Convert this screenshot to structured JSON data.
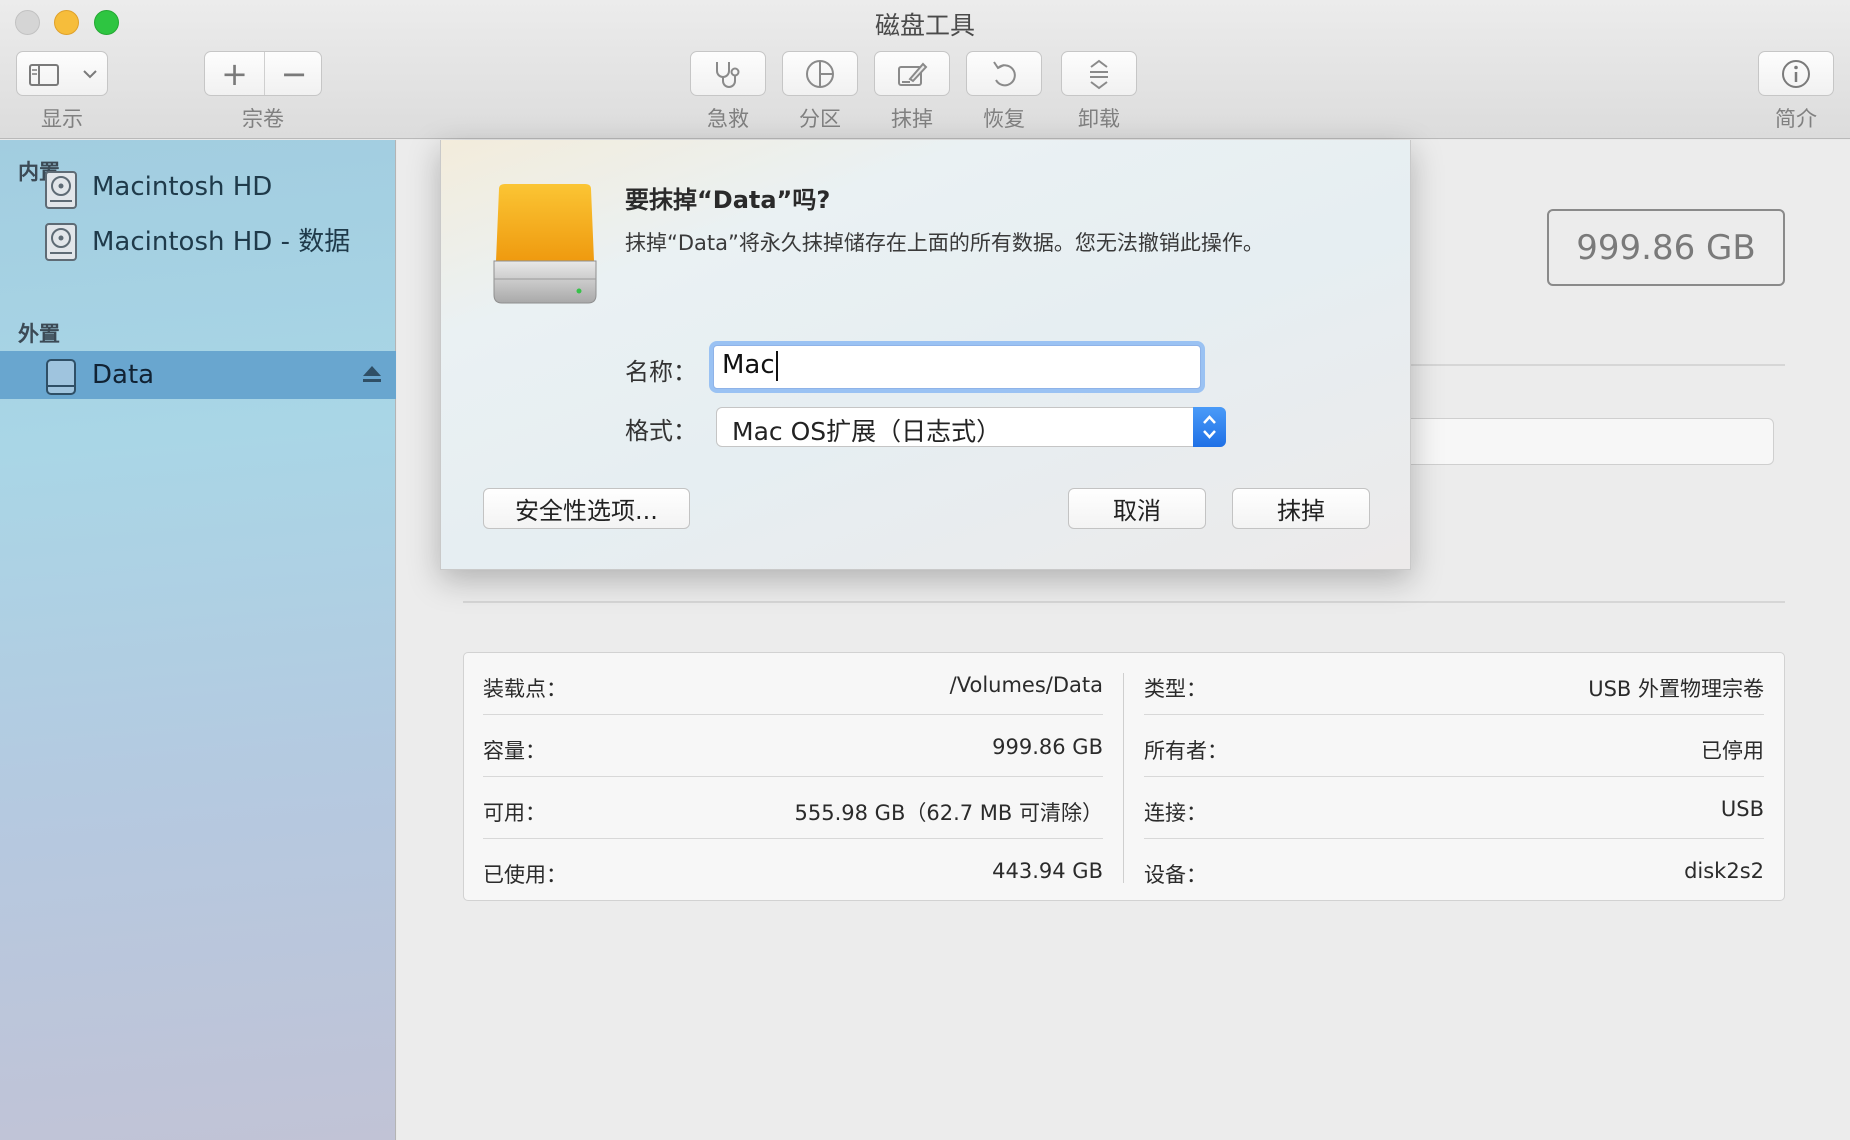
{
  "window": {
    "title": "磁盘工具"
  },
  "toolbar": {
    "view_label": "显示",
    "volume_label": "宗卷",
    "first_aid_label": "急救",
    "partition_label": "分区",
    "erase_label": "抹掉",
    "restore_label": "恢复",
    "unmount_label": "卸载",
    "info_label": "简介",
    "add_symbol": "+",
    "remove_symbol": "−"
  },
  "sidebar": {
    "internal_header": "内置",
    "external_header": "外置",
    "internal_items": [
      {
        "label": "Macintosh HD",
        "icon": "hard-disk-icon"
      },
      {
        "label": "Macintosh HD - 数据",
        "icon": "hard-disk-icon"
      }
    ],
    "external_items": [
      {
        "label": "Data",
        "icon": "external-disk-icon",
        "selected": true
      }
    ]
  },
  "main": {
    "capacity_display": "999.86 GB",
    "info": {
      "left": [
        {
          "key": "装载点：",
          "value": "/Volumes/Data"
        },
        {
          "key": "容量：",
          "value": "999.86 GB"
        },
        {
          "key": "可用：",
          "value": "555.98 GB（62.7 MB 可清除）"
        },
        {
          "key": "已使用：",
          "value": "443.94 GB"
        }
      ],
      "right": [
        {
          "key": "类型：",
          "value": "USB 外置物理宗卷"
        },
        {
          "key": "所有者：",
          "value": "已停用"
        },
        {
          "key": "连接：",
          "value": "USB"
        },
        {
          "key": "设备：",
          "value": "disk2s2"
        }
      ]
    }
  },
  "dialog": {
    "title": "要抹掉“Data”吗?",
    "message": "抹掉“Data”将永久抹掉储存在上面的所有数据。您无法撤销此操作。",
    "name_label": "名称：",
    "name_value": "Mac",
    "format_label": "格式：",
    "format_value": "Mac OS扩展（日志式）",
    "security_button": "安全性选项...",
    "cancel_button": "取消",
    "erase_button": "抹掉"
  },
  "colors": {
    "sidebar_selected": "#69a6cf",
    "accent_blue": "#2f80ed",
    "disk_orange": "#f7a81b"
  }
}
